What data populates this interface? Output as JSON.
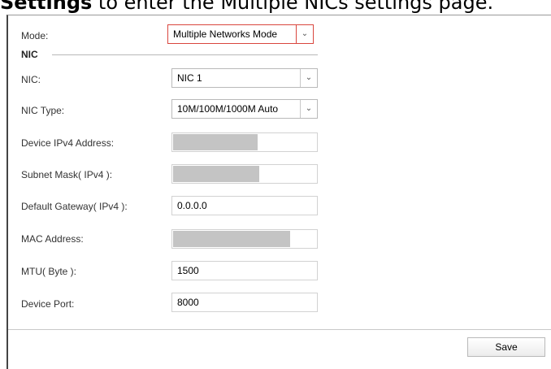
{
  "caption": {
    "bold": "Settings",
    "rest": " to enter the Multiple NICs settings page."
  },
  "mode": {
    "label": "Mode:",
    "value": "Multiple Networks Mode"
  },
  "nic_section": {
    "title": "NIC"
  },
  "nic": {
    "label": "NIC:",
    "value": "NIC 1"
  },
  "nic_type": {
    "label": "NIC Type:",
    "value": "10M/100M/1000M Auto"
  },
  "ipv4": {
    "label": "Device IPv4 Address:",
    "value": ""
  },
  "subnet": {
    "label": "Subnet Mask( IPv4 ):",
    "value": ""
  },
  "gateway": {
    "label": "Default Gateway( IPv4 ):",
    "value": "0.0.0.0"
  },
  "mac": {
    "label": "MAC Address:",
    "value": ""
  },
  "mtu": {
    "label": "MTU( Byte ):",
    "value": "1500"
  },
  "port": {
    "label": "Device Port:",
    "value": "8000"
  },
  "actions": {
    "save_label": "Save"
  },
  "icons": {
    "dropdown": "chevron-down-icon"
  }
}
